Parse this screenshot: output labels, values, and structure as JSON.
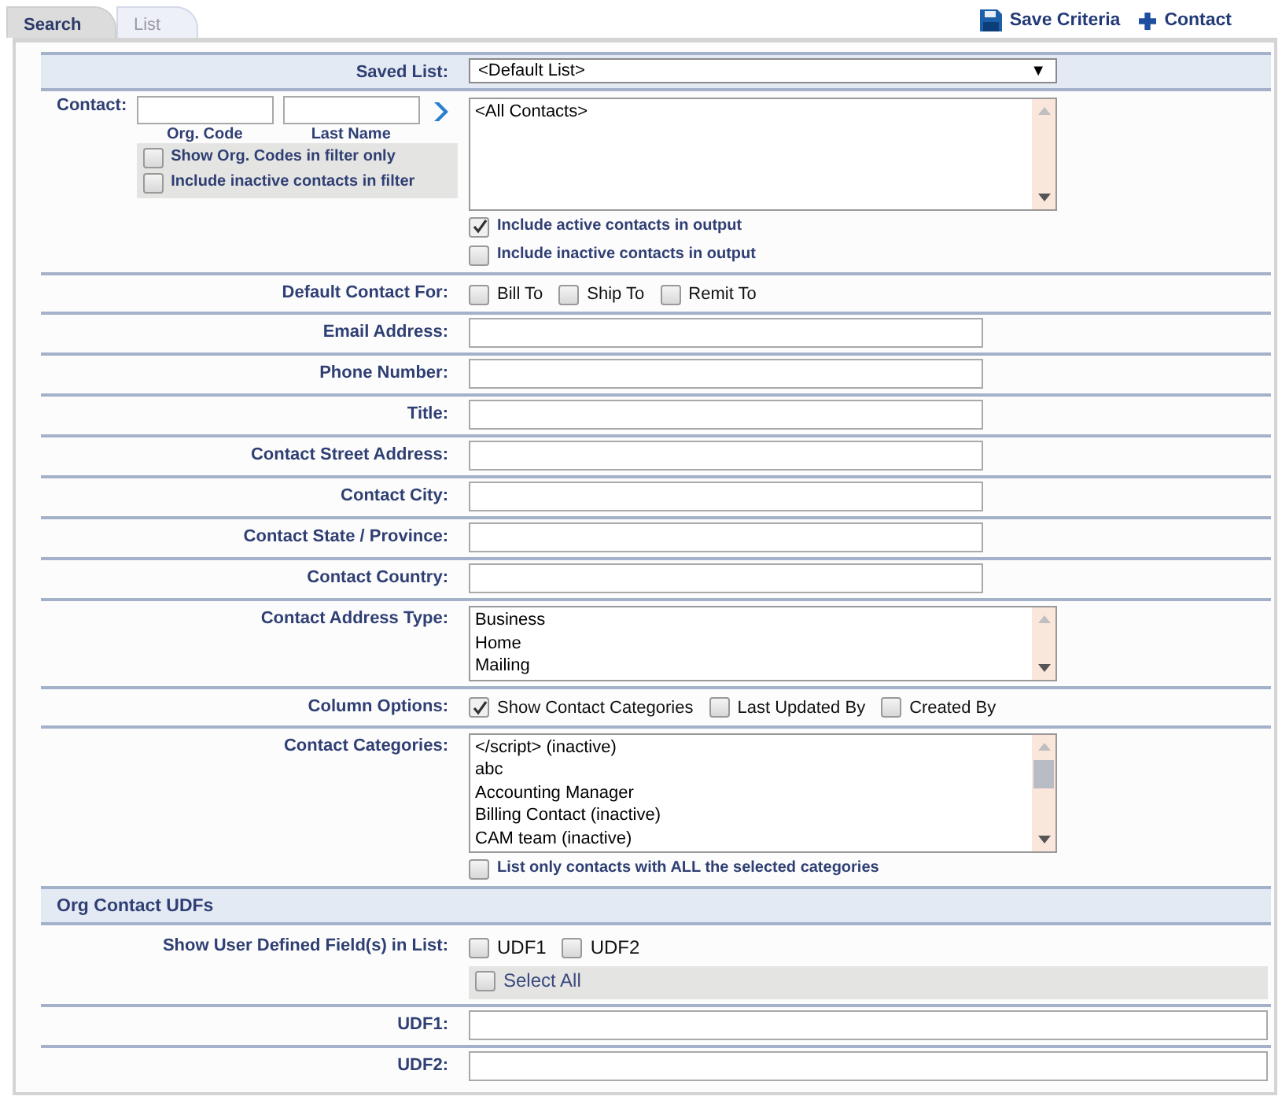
{
  "tabs": [
    {
      "label": "Search",
      "selected": true
    },
    {
      "label": "List",
      "selected": false
    }
  ],
  "toolbar": [
    {
      "kind": "save",
      "label": "Save Criteria"
    },
    {
      "kind": "add",
      "label": "Contact"
    }
  ],
  "saved_list": {
    "label": "Saved List:",
    "value": "<Default List>",
    "arrow": "▼"
  },
  "contact": {
    "label": "Contact:",
    "fields": [
      {
        "caption": "Org. Code"
      },
      {
        "caption": "Last Name"
      }
    ],
    "filter_options": [
      {
        "label": "Show Org. Codes in filter only",
        "checked": false
      },
      {
        "label": "Include inactive contacts in filter",
        "checked": false
      }
    ],
    "items": [
      "<All Contacts>"
    ],
    "output_options": [
      {
        "label": "Include active contacts in output",
        "checked": true
      },
      {
        "label": "Include inactive contacts in output",
        "checked": false
      }
    ]
  },
  "rows": [
    {
      "kind": "checkboxes",
      "label": "Default Contact For:",
      "options": [
        {
          "label": "Bill To",
          "checked": false
        },
        {
          "label": "Ship To",
          "checked": false
        },
        {
          "label": "Remit To",
          "checked": false
        }
      ]
    },
    {
      "kind": "text",
      "label": "Email Address:"
    },
    {
      "kind": "text",
      "label": "Phone Number:"
    },
    {
      "kind": "text",
      "label": "Title:"
    },
    {
      "kind": "text",
      "label": "Contact Street Address:"
    },
    {
      "kind": "text",
      "label": "Contact City:"
    },
    {
      "kind": "text",
      "label": "Contact State / Province:"
    },
    {
      "kind": "text",
      "label": "Contact Country:"
    },
    {
      "kind": "listbox",
      "label": "Contact Address Type:",
      "items": [
        "Business",
        "Home",
        "Mailing"
      ]
    },
    {
      "kind": "checkboxes",
      "label": "Column Options:",
      "options": [
        {
          "label": "Show Contact Categories",
          "checked": true
        },
        {
          "label": "Last Updated By",
          "checked": false
        },
        {
          "label": "Created By",
          "checked": false
        }
      ]
    },
    {
      "kind": "listbox",
      "label": "Contact Categories:",
      "items": [
        "</script> (inactive)",
        "abc",
        "Accounting Manager",
        "Billing Contact (inactive)",
        "CAM team (inactive)"
      ],
      "options": [
        {
          "label": "List only contacts with ALL the selected categories",
          "checked": false
        }
      ]
    }
  ],
  "udf_section": {
    "title": "Org Contact UDFs",
    "show": {
      "label": "Show User Defined Field(s) in List:",
      "options": [
        {
          "label": "UDF1",
          "checked": false
        },
        {
          "label": "UDF2",
          "checked": false
        }
      ],
      "select_all": {
        "label": "Select All",
        "checked": false
      }
    },
    "fields": [
      {
        "label": "UDF1:"
      },
      {
        "label": "UDF2:"
      }
    ]
  }
}
